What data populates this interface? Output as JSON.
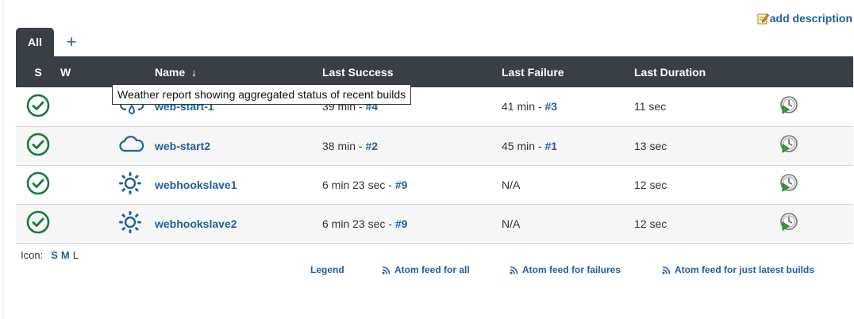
{
  "header": {
    "add_description": "add description"
  },
  "tabs": {
    "active": "All",
    "add": "+"
  },
  "columns": {
    "s": "S",
    "w": "W",
    "name": "Name",
    "name_sort": "↓",
    "last_success": "Last Success",
    "last_failure": "Last Failure",
    "last_duration": "Last Duration"
  },
  "tooltip": "Weather report showing aggregated status of recent builds",
  "jobs": [
    {
      "status_icon": "success-check-icon",
      "weather_icon": "rain-cloud-icon",
      "name": "web-start-1",
      "success_time": "39 min - ",
      "success_build": "#4",
      "failure_time": "41 min - ",
      "failure_build": "#3",
      "duration": "11 sec"
    },
    {
      "status_icon": "success-check-icon",
      "weather_icon": "cloud-icon",
      "name": "web-start2",
      "success_time": "38 min - ",
      "success_build": "#2",
      "failure_time": "45 min - ",
      "failure_build": "#1",
      "duration": "13 sec"
    },
    {
      "status_icon": "success-check-icon",
      "weather_icon": "sunny-icon",
      "name": "webhookslave1",
      "success_time": "6 min 23 sec - ",
      "success_build": "#9",
      "failure_time": "N/A",
      "failure_build": "",
      "duration": "12 sec"
    },
    {
      "status_icon": "success-check-icon",
      "weather_icon": "sunny-icon",
      "name": "webhookslave2",
      "success_time": "6 min 23 sec - ",
      "success_build": "#9",
      "failure_time": "N/A",
      "failure_build": "",
      "duration": "12 sec"
    }
  ],
  "footer": {
    "icon_label": "Icon:",
    "sizes": [
      "S",
      "M",
      "L"
    ],
    "legend": "Legend",
    "feed_all": "Atom feed for all",
    "feed_failures": "Atom feed for failures",
    "feed_latest": "Atom feed for just latest builds"
  },
  "colors": {
    "header_bg": "#3a3f46",
    "link": "#1f5f9e",
    "success": "#1a7a3a",
    "weather": "#1f5f9e"
  }
}
